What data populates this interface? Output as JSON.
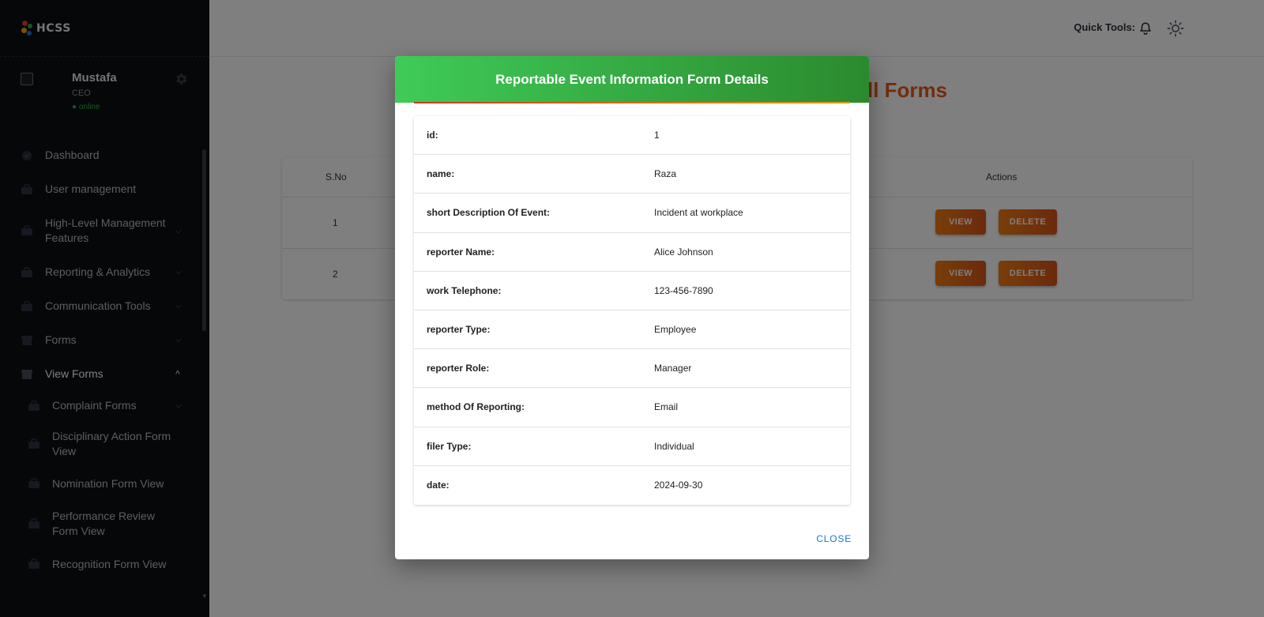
{
  "brand": {
    "name": "HCSS"
  },
  "profile": {
    "name": "Mustafa",
    "role": "CEO",
    "status": "● online"
  },
  "sidebar": {
    "items": [
      {
        "label": "Dashboard",
        "icon": "shield-icon",
        "chevron": ""
      },
      {
        "label": "User management",
        "icon": "briefcase-icon",
        "chevron": ""
      },
      {
        "label": "High-Level Management Features",
        "icon": "briefcase-icon",
        "chevron": "⌵"
      },
      {
        "label": "Reporting & Analytics",
        "icon": "briefcase-icon",
        "chevron": "⌵"
      },
      {
        "label": "Communication Tools",
        "icon": "briefcase-icon",
        "chevron": "⌵"
      },
      {
        "label": "Forms",
        "icon": "archive-icon",
        "chevron": "⌵"
      },
      {
        "label": "View Forms",
        "icon": "archive-icon",
        "chevron": "^"
      },
      {
        "label": "Complaint Forms",
        "icon": "briefcase-icon",
        "chevron": "⌵"
      },
      {
        "label": "Disciplinary Action Form View",
        "icon": "briefcase-icon",
        "chevron": ""
      },
      {
        "label": "Nomination Form View",
        "icon": "briefcase-icon",
        "chevron": ""
      },
      {
        "label": "Performance Review Form View",
        "icon": "briefcase-icon",
        "chevron": ""
      },
      {
        "label": "Recognition Form View",
        "icon": "briefcase-icon",
        "chevron": ""
      }
    ]
  },
  "topbar": {
    "quick_tools_label": "Quick Tools:",
    "icons": [
      "bell-icon",
      "sun-icon"
    ]
  },
  "page": {
    "title": "ll Forms",
    "table": {
      "headers": {
        "sno": "S.No",
        "actions": "Actions"
      },
      "rows": [
        {
          "sno": "1",
          "view_label": "VIEW",
          "delete_label": "DELETE"
        },
        {
          "sno": "2",
          "view_label": "VIEW",
          "delete_label": "DELETE"
        }
      ]
    }
  },
  "modal": {
    "title": "Reportable Event Information Form Details",
    "fields": [
      {
        "key": "id:",
        "value": "1"
      },
      {
        "key": "name:",
        "value": "Raza"
      },
      {
        "key": "short Description Of Event:",
        "value": "Incident at workplace"
      },
      {
        "key": "reporter Name:",
        "value": "Alice Johnson"
      },
      {
        "key": "work Telephone:",
        "value": "123-456-7890"
      },
      {
        "key": "reporter Type:",
        "value": "Employee"
      },
      {
        "key": "reporter Role:",
        "value": "Manager"
      },
      {
        "key": "method Of Reporting:",
        "value": "Email"
      },
      {
        "key": "filer Type:",
        "value": "Individual"
      },
      {
        "key": "date:",
        "value": "2024-09-30"
      }
    ],
    "close_label": "CLOSE"
  },
  "colors": {
    "sidebar_bg": "#0d0e12",
    "accent_orange": "#e8591a",
    "header_green_start": "#3fcb57",
    "header_green_end": "#2b8a2e",
    "link_blue": "#1976d2",
    "status_green": "#2fb344"
  }
}
